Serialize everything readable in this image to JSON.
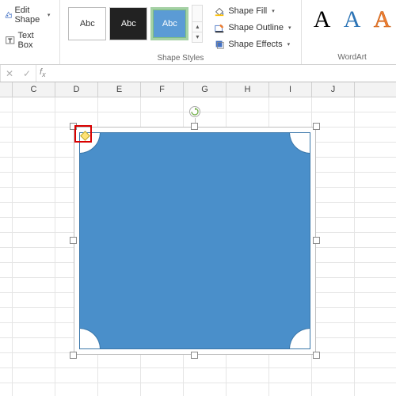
{
  "ribbon": {
    "insert_shapes": {
      "edit_shape": "Edit Shape",
      "text_box": "Text Box"
    },
    "shape_styles": {
      "group_label": "Shape Styles",
      "swatch_label": "Abc",
      "shape_fill": "Shape Fill",
      "shape_outline": "Shape Outline",
      "shape_effects": "Shape Effects"
    },
    "wordart": {
      "group_label": "WordArt",
      "glyph": "A"
    }
  },
  "columns": [
    "C",
    "D",
    "E",
    "F",
    "G",
    "H",
    "I",
    "J"
  ],
  "colors": {
    "shape_fill": "#4a8fca",
    "shape_border": "#3a77aa",
    "highlight_box": "#d90000"
  }
}
